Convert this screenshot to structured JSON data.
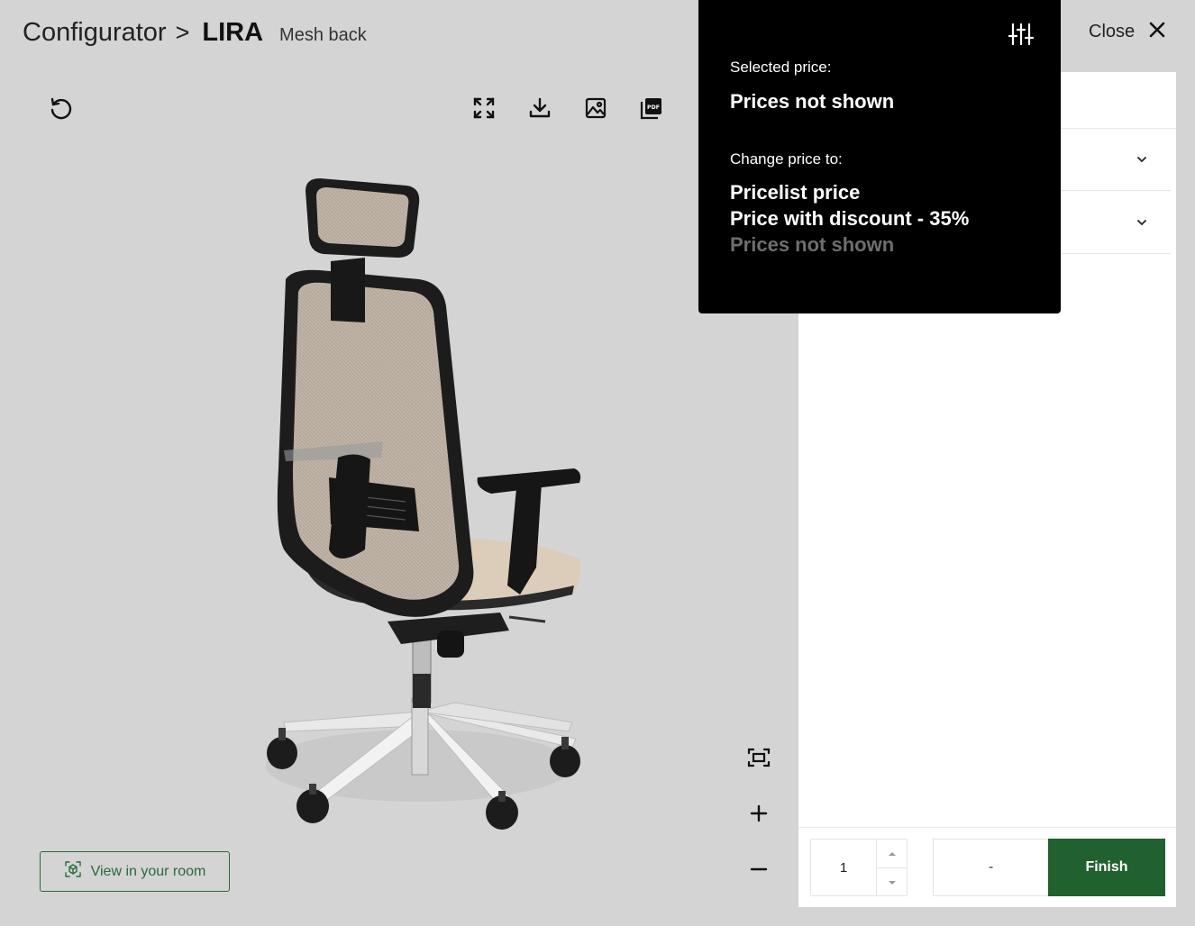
{
  "header": {
    "breadcrumb_root": "Configurator",
    "breadcrumb_separator": ">",
    "product_name": "LIRA",
    "product_variant": "Mesh back",
    "close_label": "Close"
  },
  "viewer": {
    "toolbar_icons": [
      "reset-rotation-icon",
      "fullscreen-icon",
      "download-icon",
      "image-icon",
      "pdf-icon"
    ],
    "view_in_room_label": "View in your room",
    "zoom_controls": [
      "fit-to-screen-icon",
      "zoom-in-icon",
      "zoom-out-icon"
    ]
  },
  "price_popover": {
    "selected_label": "Selected price:",
    "selected_value": "Prices not shown",
    "change_label": "Change price to:",
    "options": [
      {
        "label": "Pricelist price",
        "enabled": true
      },
      {
        "label": "Price with discount - 35%",
        "enabled": true
      },
      {
        "label": "Prices not shown",
        "enabled": false
      }
    ]
  },
  "panel": {
    "quantity": "1",
    "price": "-",
    "finish_label": "Finish"
  },
  "colors": {
    "background": "#d4d4d4",
    "accent_green": "#21602f",
    "popover_bg": "#000000",
    "disabled_option": "#6e6e6e"
  }
}
